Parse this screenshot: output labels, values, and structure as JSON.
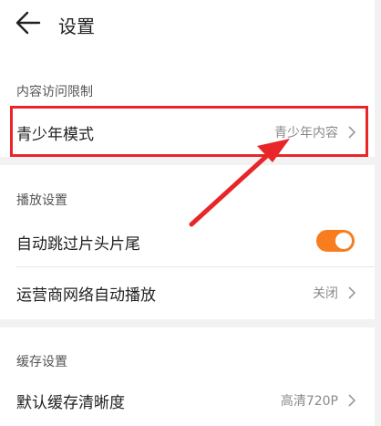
{
  "header": {
    "title": "设置"
  },
  "sections": {
    "content_restriction": {
      "title": "内容访问限制",
      "youth_mode": {
        "label": "青少年模式",
        "value": "青少年内容"
      }
    },
    "playback": {
      "title": "播放设置",
      "skip_intro": {
        "label": "自动跳过片头片尾",
        "enabled": true
      },
      "carrier_autoplay": {
        "label": "运营商网络自动播放",
        "value": "关闭"
      }
    },
    "cache": {
      "title": "缓存设置",
      "default_quality": {
        "label": "默认缓存清晰度",
        "value": "高清720P"
      }
    }
  },
  "colors": {
    "toggle_on": "#f77d1e",
    "annotation": "#e8262a",
    "band": "#f2f2f2"
  },
  "icons": {
    "back": "arrow-left-icon",
    "chevron": "chevron-right-icon"
  }
}
